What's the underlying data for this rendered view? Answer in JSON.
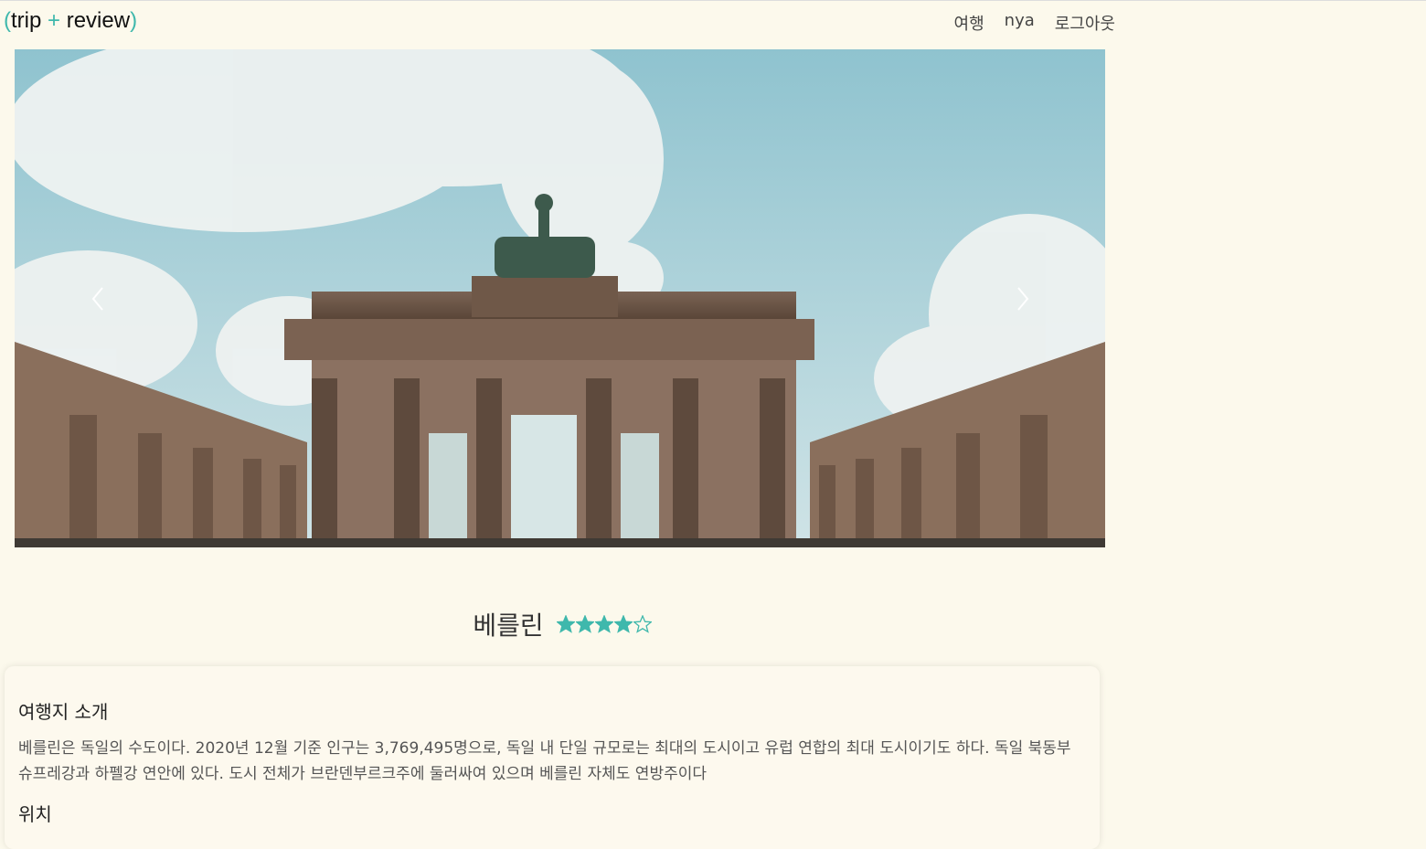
{
  "header": {
    "logo": {
      "open": "(",
      "trip": "trip",
      "plus": "+",
      "review": "review",
      "close": ")"
    },
    "nav": [
      "여행",
      "nya",
      "로그아웃"
    ]
  },
  "carousel": {
    "prev_icon": "chevron-left-icon",
    "next_icon": "chevron-right-icon"
  },
  "place": {
    "name": "베를린",
    "rating": 4,
    "rating_max": 5,
    "accent_color": "#3fb8ac"
  },
  "info": {
    "intro_heading": "여행지 소개",
    "intro_text": "베를린은 독일의 수도이다. 2020년 12월 기준 인구는 3,769,495명으로, 독일 내 단일 규모로는 최대의 도시이고 유럽 연합의 최대 도시이기도 하다. 독일 북동부 슈프레강과 하펠강 연안에 있다. 도시 전체가 브란덴부르크주에 둘러싸여 있으며 베를린 자체도 연방주이다",
    "location_heading": "위치"
  }
}
